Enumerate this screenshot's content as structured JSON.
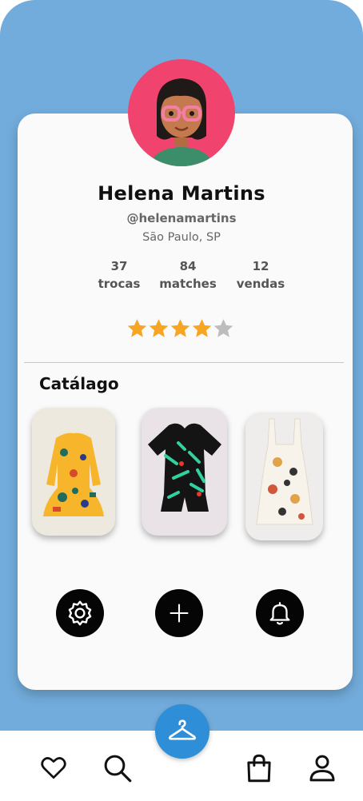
{
  "profile": {
    "name": "Helena Martins",
    "handle": "@helenamartins",
    "location": "São Paulo, SP",
    "rating": 4,
    "rating_max": 5
  },
  "stats": [
    {
      "value": "37",
      "label": "trocas"
    },
    {
      "value": "84",
      "label": "matches"
    },
    {
      "value": "12",
      "label": "vendas"
    }
  ],
  "catalog": {
    "title": "Catálago",
    "items": [
      {
        "icon": "yellow-dress-image"
      },
      {
        "icon": "black-romper-image"
      },
      {
        "icon": "printed-overall-image"
      }
    ]
  },
  "actions": [
    {
      "icon": "gear-icon"
    },
    {
      "icon": "plus-icon"
    },
    {
      "icon": "bell-icon"
    }
  ],
  "nav": {
    "items": [
      "heart-icon",
      "search-icon",
      "hanger-icon",
      "shopping-bag-icon",
      "user-icon"
    ],
    "active": "hanger-icon"
  },
  "colors": {
    "background": "#72ACDC",
    "avatar_bg": "#F0446E",
    "star_on": "#F6A623",
    "star_off": "#BDBDBD",
    "fab": "#2E8FD8"
  }
}
